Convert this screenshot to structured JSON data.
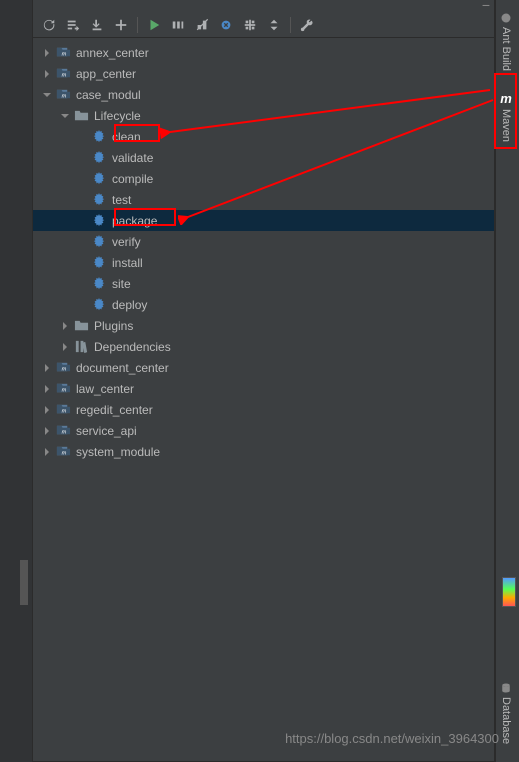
{
  "panel_title": "Maven",
  "toolbar": {
    "refresh": "refresh",
    "generate": "generate",
    "download": "download",
    "add": "add",
    "run": "run",
    "execute": "execute",
    "toggle": "toggle",
    "cycle": "cycle",
    "collapse": "collapse",
    "settings_dropdown": "settings_dropdown",
    "wrench": "wrench"
  },
  "tree": {
    "modules": [
      {
        "label": "annex_center",
        "expanded": false
      },
      {
        "label": "app_center",
        "expanded": false
      },
      {
        "label": "case_modul",
        "expanded": true
      },
      {
        "label": "document_center",
        "expanded": false
      },
      {
        "label": "law_center",
        "expanded": false
      },
      {
        "label": "regedit_center",
        "expanded": false
      },
      {
        "label": "service_api",
        "expanded": false
      },
      {
        "label": "system_module",
        "expanded": false
      }
    ],
    "lifecycle": {
      "label": "Lifecycle",
      "goals": [
        "clean",
        "validate",
        "compile",
        "test",
        "package",
        "verify",
        "install",
        "site",
        "deploy"
      ]
    },
    "plugins_label": "Plugins",
    "dependencies_label": "Dependencies"
  },
  "sidebar": {
    "ant_build": "Ant Build",
    "maven": "Maven",
    "database": "Database"
  },
  "watermark": "https://blog.csdn.net/weixin_3964300"
}
